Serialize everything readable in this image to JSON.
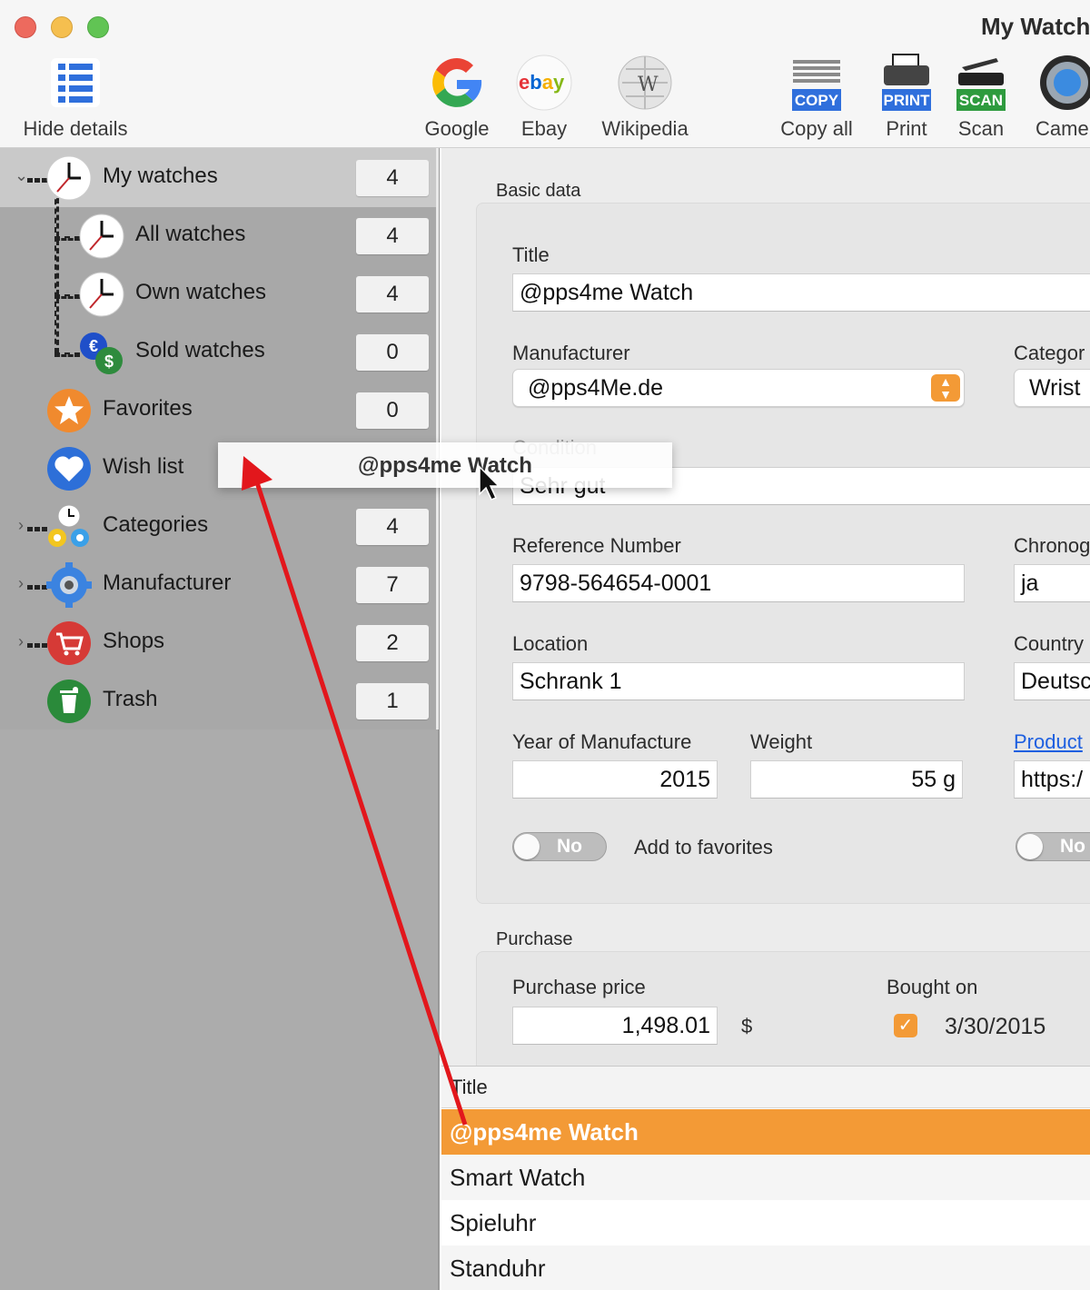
{
  "window": {
    "title": "My Watch"
  },
  "toolbar": {
    "hide_details": "Hide details",
    "google": "Google",
    "ebay": "Ebay",
    "wikipedia": "Wikipedia",
    "copy_all": "Copy all",
    "copy_badge": "COPY",
    "print": "Print",
    "print_badge": "PRINT",
    "scan": "Scan",
    "scan_badge": "SCAN",
    "camera": "Came"
  },
  "sidebar": {
    "items": [
      {
        "label": "My watches",
        "count": "4"
      },
      {
        "label": "All watches",
        "count": "4"
      },
      {
        "label": "Own watches",
        "count": "4"
      },
      {
        "label": "Sold watches",
        "count": "0"
      },
      {
        "label": "Favorites",
        "count": "0"
      },
      {
        "label": "Wish list",
        "count": ""
      },
      {
        "label": "Categories",
        "count": "4"
      },
      {
        "label": "Manufacturer",
        "count": "7"
      },
      {
        "label": "Shops",
        "count": "2"
      },
      {
        "label": "Trash",
        "count": "1"
      }
    ]
  },
  "basic": {
    "section": "Basic data",
    "title_label": "Title",
    "title_value": "@pps4me Watch",
    "manufacturer_label": "Manufacturer",
    "manufacturer_value": "@pps4Me.de",
    "category_label": "Categor",
    "category_value": "Wrist",
    "condition_label": "Condition",
    "condition_value": "Sehr gut",
    "reference_label": "Reference Number",
    "reference_value": "9798-564654-0001",
    "chrono_label": "Chronog",
    "chrono_value": "ja",
    "location_label": "Location",
    "location_value": "Schrank 1",
    "country_label": "Country",
    "country_value": "Deutsc",
    "year_label": "Year of Manufacture",
    "year_value": "2015",
    "weight_label": "Weight",
    "weight_value": "55 g",
    "product_link": "Product",
    "product_value": "https:/",
    "toggle_text": "No",
    "favorites_label": "Add to favorites",
    "toggle2_text": "No"
  },
  "purchase": {
    "section": "Purchase",
    "price_label": "Purchase price",
    "price_value": "1,498.01",
    "currency": "$",
    "bought_label": "Bought on",
    "bought_value": "3/30/2015"
  },
  "list": {
    "header": "Title",
    "rows": [
      "@pps4me Watch",
      "Smart Watch",
      "Spieluhr",
      "Standuhr"
    ]
  },
  "drag": {
    "text": "@pps4me Watch"
  },
  "colors": {
    "accent": "#f39a36",
    "selection": "#f39a36",
    "arrow": "#e2171c",
    "link": "#1d5fe0"
  }
}
